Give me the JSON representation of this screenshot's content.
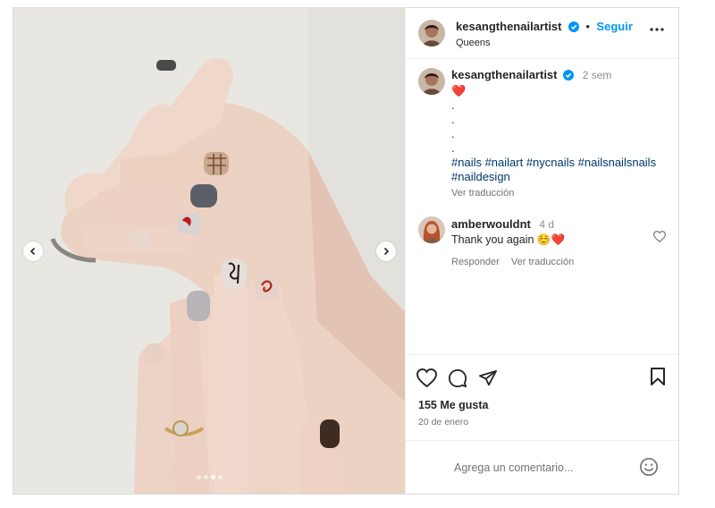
{
  "post": {
    "username": "kesangthenailartist",
    "location": "Queens",
    "follow_label": "Seguir",
    "separator": "•",
    "caption": {
      "time": "2 sem",
      "emoji": "❤️",
      "dots": [
        ".",
        ".",
        ".",
        "."
      ],
      "hashtags": "#nails #nailart #nycnails #nailsnailsnails #naildesign",
      "translate_label": "Ver traducción"
    },
    "comments": [
      {
        "username": "amberwouldnt",
        "time": "4 d",
        "text": "Thank you again ☺️❤️",
        "reply_label": "Responder",
        "translate_label": "Ver traducción"
      }
    ],
    "likes": "155 Me gusta",
    "date": "20 de enero",
    "comment_placeholder": "Agrega un comentario...",
    "carousel": {
      "slides": 4,
      "active": 2
    }
  },
  "icons": {
    "verified": "verified-badge-icon",
    "more": "more-options-icon",
    "like": "heart-icon",
    "comment": "comment-icon",
    "share": "share-icon",
    "save": "bookmark-icon",
    "emoji": "emoji-icon",
    "prev": "chevron-left-icon",
    "next": "chevron-right-icon"
  },
  "colors": {
    "accent": "#0095f6",
    "verified": "#0095f6",
    "heart": "#ed4956",
    "hashtag": "#00376b"
  }
}
